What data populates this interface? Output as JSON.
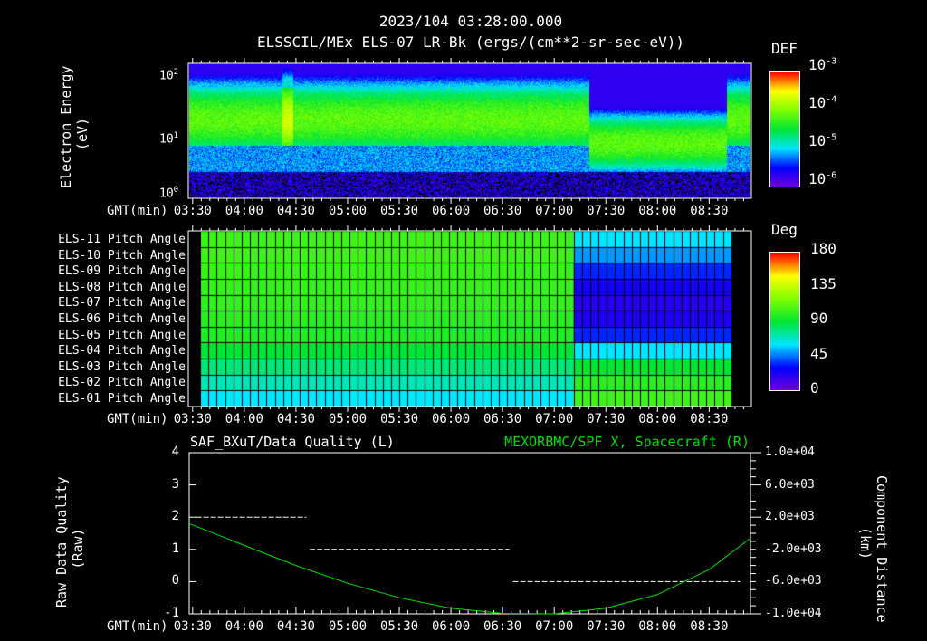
{
  "header": {
    "datetime": "2023/104 03:28:00.000",
    "title": "ELSSCIL/MEx ELS-07 LR-Bk  (ergs/(cm**2-sr-sec-eV))"
  },
  "time_axis": {
    "label": "GMT(min)",
    "ticks": [
      "03:30",
      "04:00",
      "04:30",
      "05:00",
      "05:30",
      "06:00",
      "06:30",
      "07:00",
      "07:30",
      "08:00",
      "08:30"
    ],
    "range_min": [
      208,
      534
    ]
  },
  "chart_data": [
    {
      "type": "heatmap",
      "title": "ELSSCIL/MEx ELS-07 LR-Bk",
      "ylabel": "Electron Energy",
      "yunit": "(eV)",
      "yscale": "log",
      "ylim": [
        1,
        200
      ],
      "yticks": [
        "10",
        "10",
        "10"
      ],
      "ytick_exp": [
        "2",
        "1",
        "0"
      ],
      "colorbar": {
        "label": "DEF",
        "ticks": [
          "10",
          "10",
          "10",
          "10"
        ],
        "tick_exp": [
          "-3",
          "-4",
          "-5",
          "-6"
        ],
        "range": [
          1e-06,
          0.001
        ]
      }
    },
    {
      "type": "heatmap",
      "rows": [
        "ELS-11 Pitch Angle",
        "ELS-10 Pitch Angle",
        "ELS-09 Pitch Angle",
        "ELS-08 Pitch Angle",
        "ELS-07 Pitch Angle",
        "ELS-06 Pitch Angle",
        "ELS-05 Pitch Angle",
        "ELS-04 Pitch Angle",
        "ELS-03 Pitch Angle",
        "ELS-02 Pitch Angle",
        "ELS-01 Pitch Angle"
      ],
      "switch_min": 435,
      "values_before": [
        105,
        105,
        104,
        103,
        102,
        100,
        98,
        90,
        80,
        70,
        60
      ],
      "values_after": [
        60,
        50,
        35,
        25,
        20,
        22,
        35,
        60,
        90,
        100,
        105
      ],
      "colorbar": {
        "label": "Deg",
        "ticks": [
          "180",
          "135",
          "90",
          "45",
          "0"
        ],
        "range": [
          0,
          180
        ]
      }
    },
    {
      "type": "line",
      "title_left": "SAF_BXuT/Data Quality (L)",
      "title_right": "MEXORBMC/SPF X, Spacecraft (R)",
      "ylabel_left": "Raw Data Quality",
      "yunit_left": "(Raw)",
      "ylim_left": [
        -1,
        4
      ],
      "yticks_left": [
        "4",
        "3",
        "2",
        "1",
        "0",
        "-1"
      ],
      "ylabel_right": "Component Distance",
      "yunit_right": "(km)",
      "ylim_right": [
        -10000,
        10000
      ],
      "yticks_right": [
        "1.0e+04",
        "6.0e+03",
        "2.0e+03",
        "-2.0e+03",
        "-6.0e+03",
        "-1.0e+04"
      ],
      "quality": [
        {
          "start": 212,
          "end": 276,
          "value": 2
        },
        {
          "start": 278,
          "end": 394,
          "value": 1
        },
        {
          "start": 396,
          "end": 528,
          "value": 0
        }
      ],
      "x_position": {
        "minutes": [
          208,
          240,
          270,
          300,
          330,
          360,
          390,
          420,
          450,
          480,
          510,
          534
        ],
        "km": [
          1200,
          -1500,
          -4000,
          -6200,
          -8000,
          -9300,
          -9950,
          -10000,
          -9300,
          -7600,
          -4500,
          -600
        ]
      },
      "colors": {
        "quality": "#ffffff",
        "position": "#00e000"
      }
    }
  ]
}
